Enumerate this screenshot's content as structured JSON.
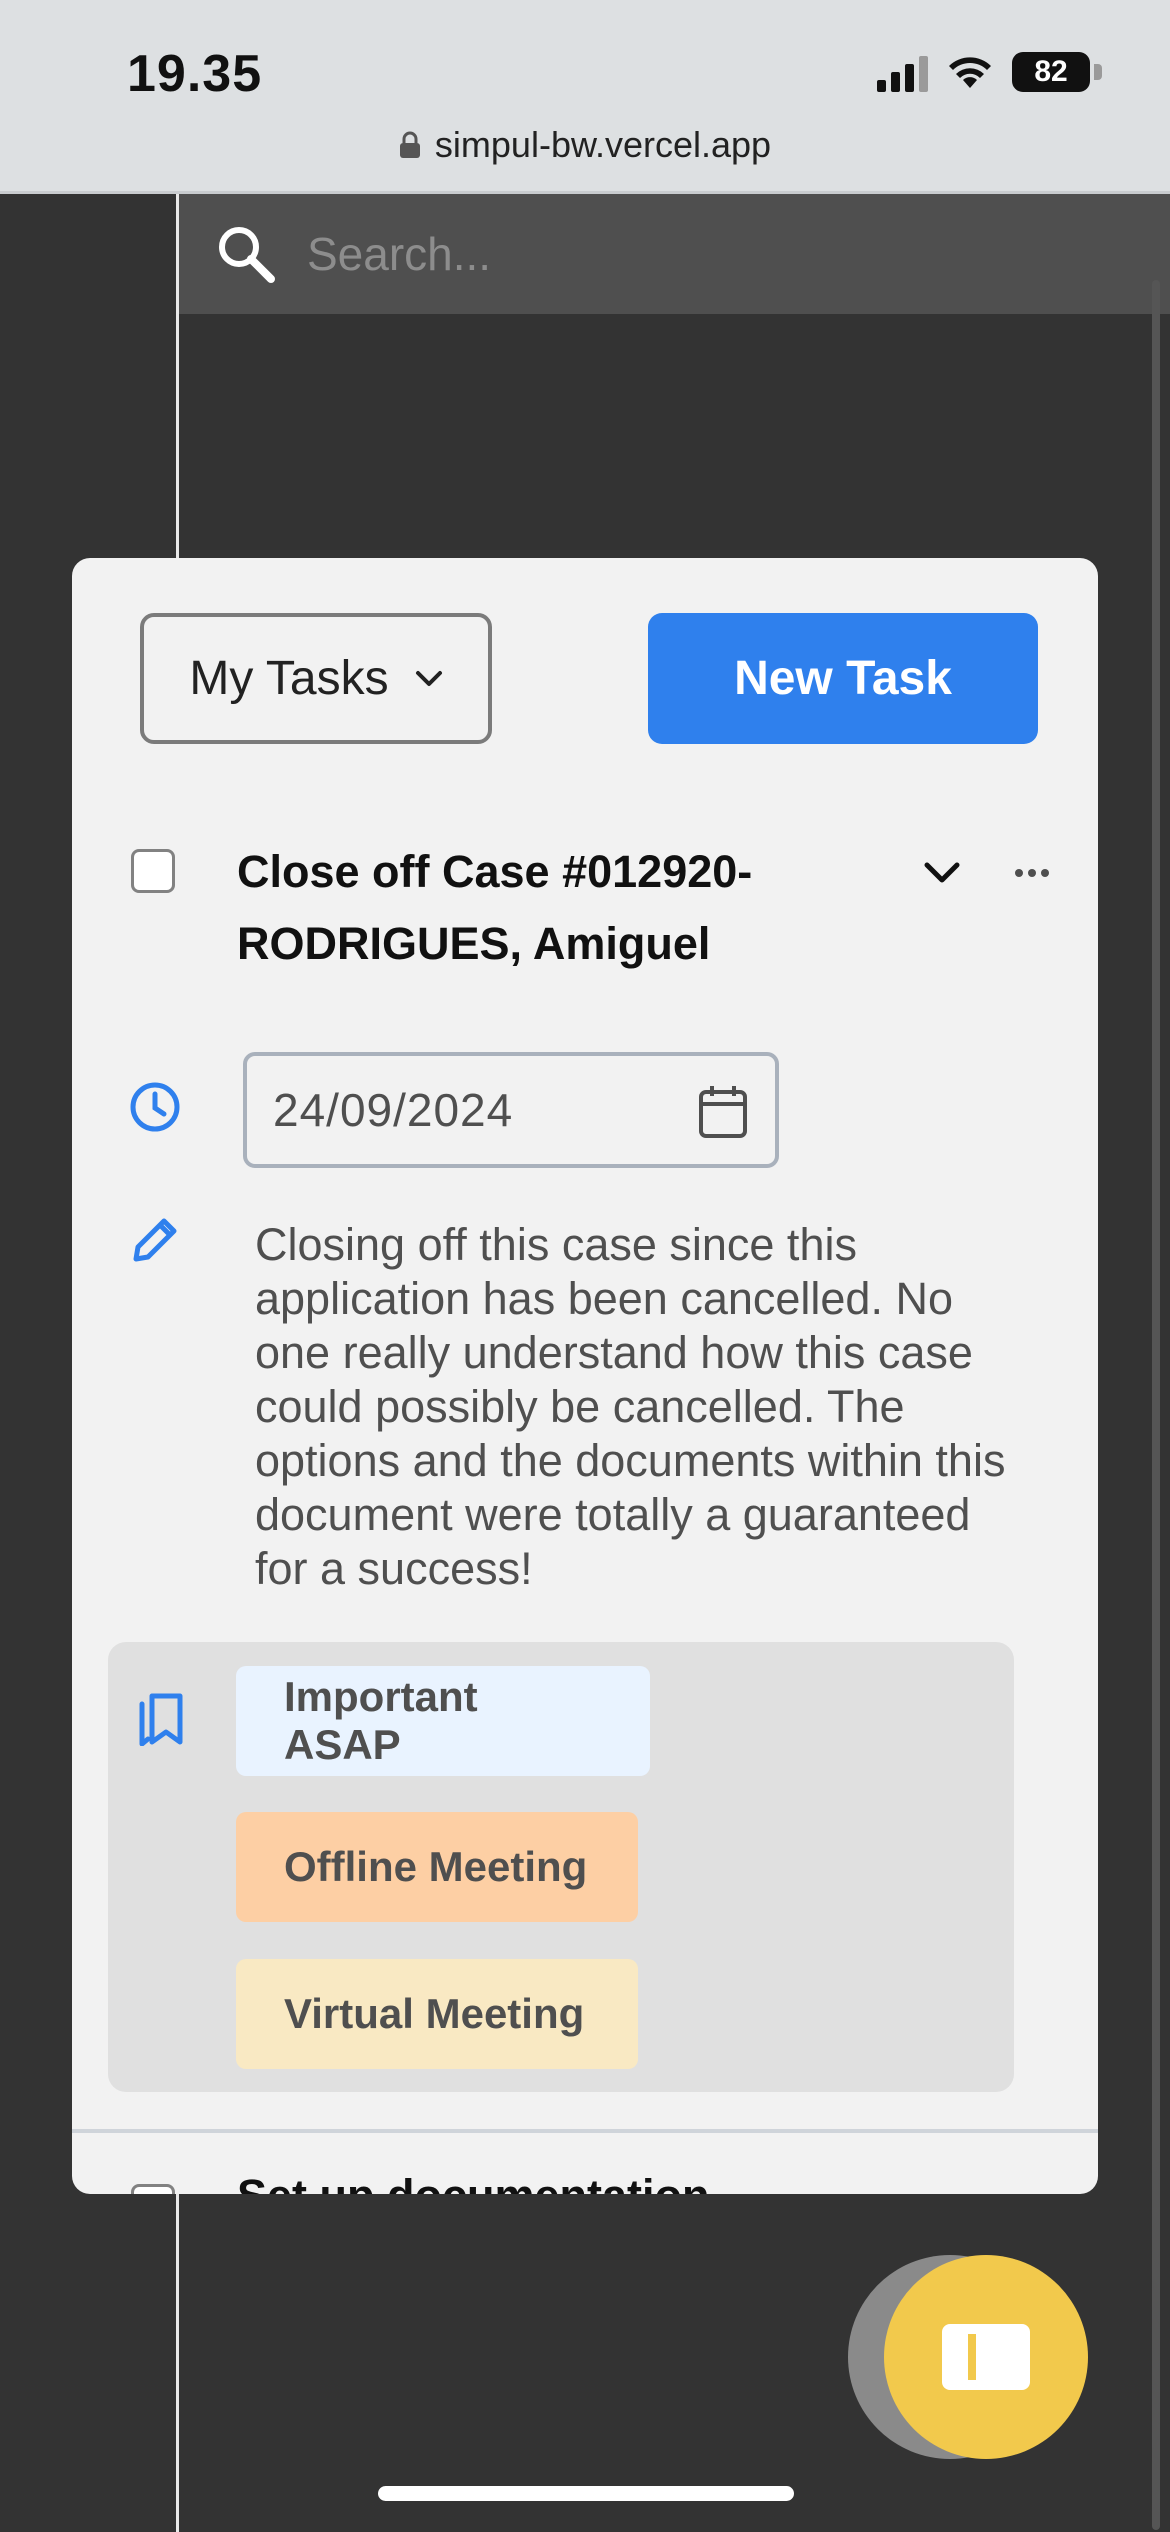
{
  "status_bar": {
    "time": "19.35",
    "battery": "82",
    "url": "simpul-bw.vercel.app"
  },
  "search": {
    "placeholder": "Search..."
  },
  "panel": {
    "filter_label": "My Tasks",
    "new_task_label": "New Task",
    "task": {
      "title": "Close off Case #012920- RODRIGUES, Amiguel",
      "date": "24/09/2024",
      "description": "Closing off this case since this application has been cancelled. No one really understand how this case could possibly be cancelled. The options and the documents within this document were totally a guaranteed for a success!",
      "tags": [
        {
          "label": "Important ASAP",
          "color": "#e9f3ff"
        },
        {
          "label": "Offline Meeting",
          "color": "#fdcfa4"
        },
        {
          "label": "Virtual Meeting",
          "color": "#f9e9c3"
        }
      ]
    },
    "next_task_title": "Set up documentation"
  },
  "colors": {
    "accent": "#2f80ed",
    "fab": "#f2c94c",
    "background": "#333333"
  },
  "icons": [
    "lock-icon",
    "search-icon",
    "chevron-down-icon",
    "more-horizontal-icon",
    "clock-icon",
    "calendar-icon",
    "pencil-icon",
    "bookmarks-icon",
    "sidebar-toggle-icon"
  ]
}
